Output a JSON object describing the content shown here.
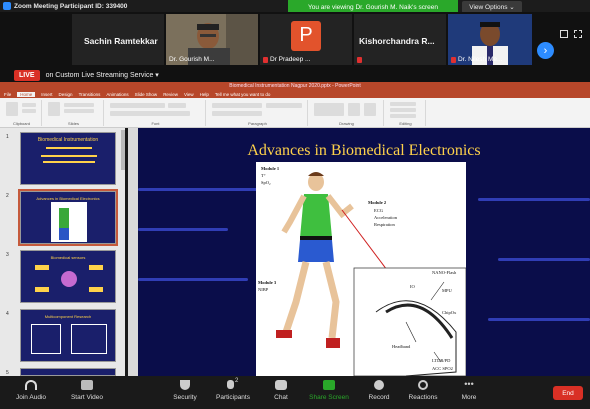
{
  "window": {
    "title": "Zoom Meeting Participant ID: 339400"
  },
  "banner": {
    "viewing": "You are viewing Dr. Gourish M. Naik's screen",
    "view_options": "View Options"
  },
  "participants": [
    {
      "name": "Sachin Ramtekkar"
    },
    {
      "label": "Dr. Gourish M..."
    },
    {
      "label": "Dr Pradeep ..."
    },
    {
      "name": "Kishorchandra R..."
    },
    {
      "label": "Dr. Nilesh Me..."
    }
  ],
  "pradeep_avatar_letter": "P",
  "live": {
    "badge": "LIVE",
    "service": "on Custom Live Streaming Service"
  },
  "ppt": {
    "window_title": "Biomedical Instrumentation Nagpur 2020.pptx - PowerPoint",
    "tabs": [
      "File",
      "Home",
      "Insert",
      "Design",
      "Transitions",
      "Animations",
      "Slide Show",
      "Review",
      "View",
      "Help",
      "Tell me what you want to do"
    ],
    "groups": [
      "Clipboard",
      "Slides",
      "Font",
      "Paragraph",
      "Drawing",
      "Editing"
    ]
  },
  "thumbnails": [
    {
      "num": "1",
      "title": "Biomedical Instrumentation"
    },
    {
      "num": "2",
      "title": "Advances in Biomedical Electronics"
    },
    {
      "num": "3",
      "title": "Biomedical sensors"
    },
    {
      "num": "4",
      "title": "Multicomponent Research"
    },
    {
      "num": "5",
      "title": ""
    }
  ],
  "slide": {
    "title": "Advances in Biomedical Electronics",
    "labels": {
      "module1": "Module 1",
      "m1_a": "T°",
      "m1_b": "SpO₂",
      "module2": "Module 2",
      "m2_a": "ECG",
      "m2_b": "Acceleration",
      "m2_c": "Respiration",
      "module3": "Module 3",
      "m3_a": "NIBP",
      "nano": "NANO-Flash",
      "mpu": "MPU",
      "chipox": "ChipOx",
      "io": "IO",
      "headband": "Headband",
      "ltdrpd": "LTDR/PD",
      "acc": "ACC   SPO2"
    }
  },
  "toolbar": {
    "join_audio": "Join Audio",
    "start_video": "Start Video",
    "security": "Security",
    "participants": "Participants",
    "participants_count": "2",
    "chat": "Chat",
    "share_screen": "Share Screen",
    "record": "Record",
    "reactions": "Reactions",
    "more": "More",
    "end": "End"
  },
  "colors": {
    "zoom_blue": "#2d8cff",
    "share_green": "#2aa82a",
    "end_red": "#d93025",
    "ppt_orange": "#b7472a",
    "slide_navy": "#0a0d4a",
    "slide_title_yellow": "#ffd24a"
  }
}
